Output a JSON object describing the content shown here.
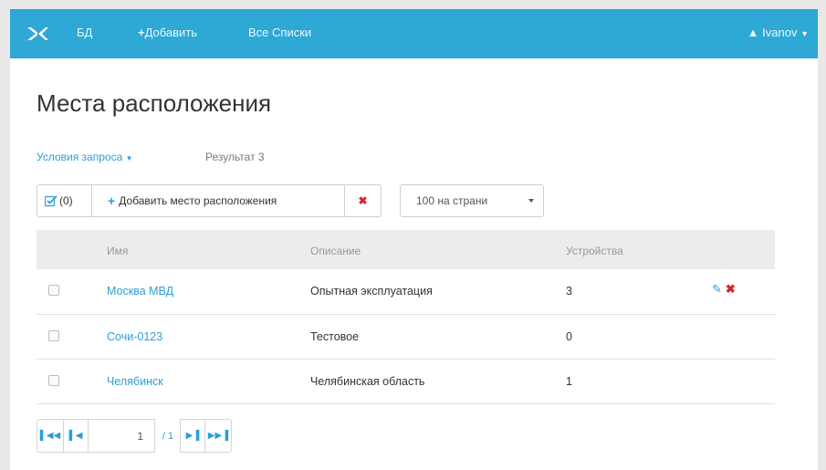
{
  "navbar": {
    "logo": "logo-icon",
    "links": [
      "БД",
      "Добавить",
      "Все Списки"
    ],
    "user": "Ivanov"
  },
  "page": {
    "title": "Места расположения",
    "query_conditions": "Условия запроса",
    "result": "Результат 3"
  },
  "toolbar": {
    "selected_count": "(0)",
    "add_label": "Добавить место расположения",
    "per_page": "100 на страни"
  },
  "table": {
    "headers": [
      "Имя",
      "Описание",
      "Устройства"
    ],
    "rows": [
      {
        "name": "Москва МВД",
        "description": "Опытная эксплуатация",
        "devices": "3"
      },
      {
        "name": "Сочи-0123",
        "description": "Тестовое",
        "devices": "0"
      },
      {
        "name": "Челябинск",
        "description": "Челябинская область",
        "devices": "1"
      }
    ]
  },
  "pagination": {
    "current_page": "1",
    "total": "/ 1"
  },
  "colors": {
    "navbar": "#2ea8d4",
    "link": "#2a9fd6",
    "danger": "#d9232d"
  }
}
